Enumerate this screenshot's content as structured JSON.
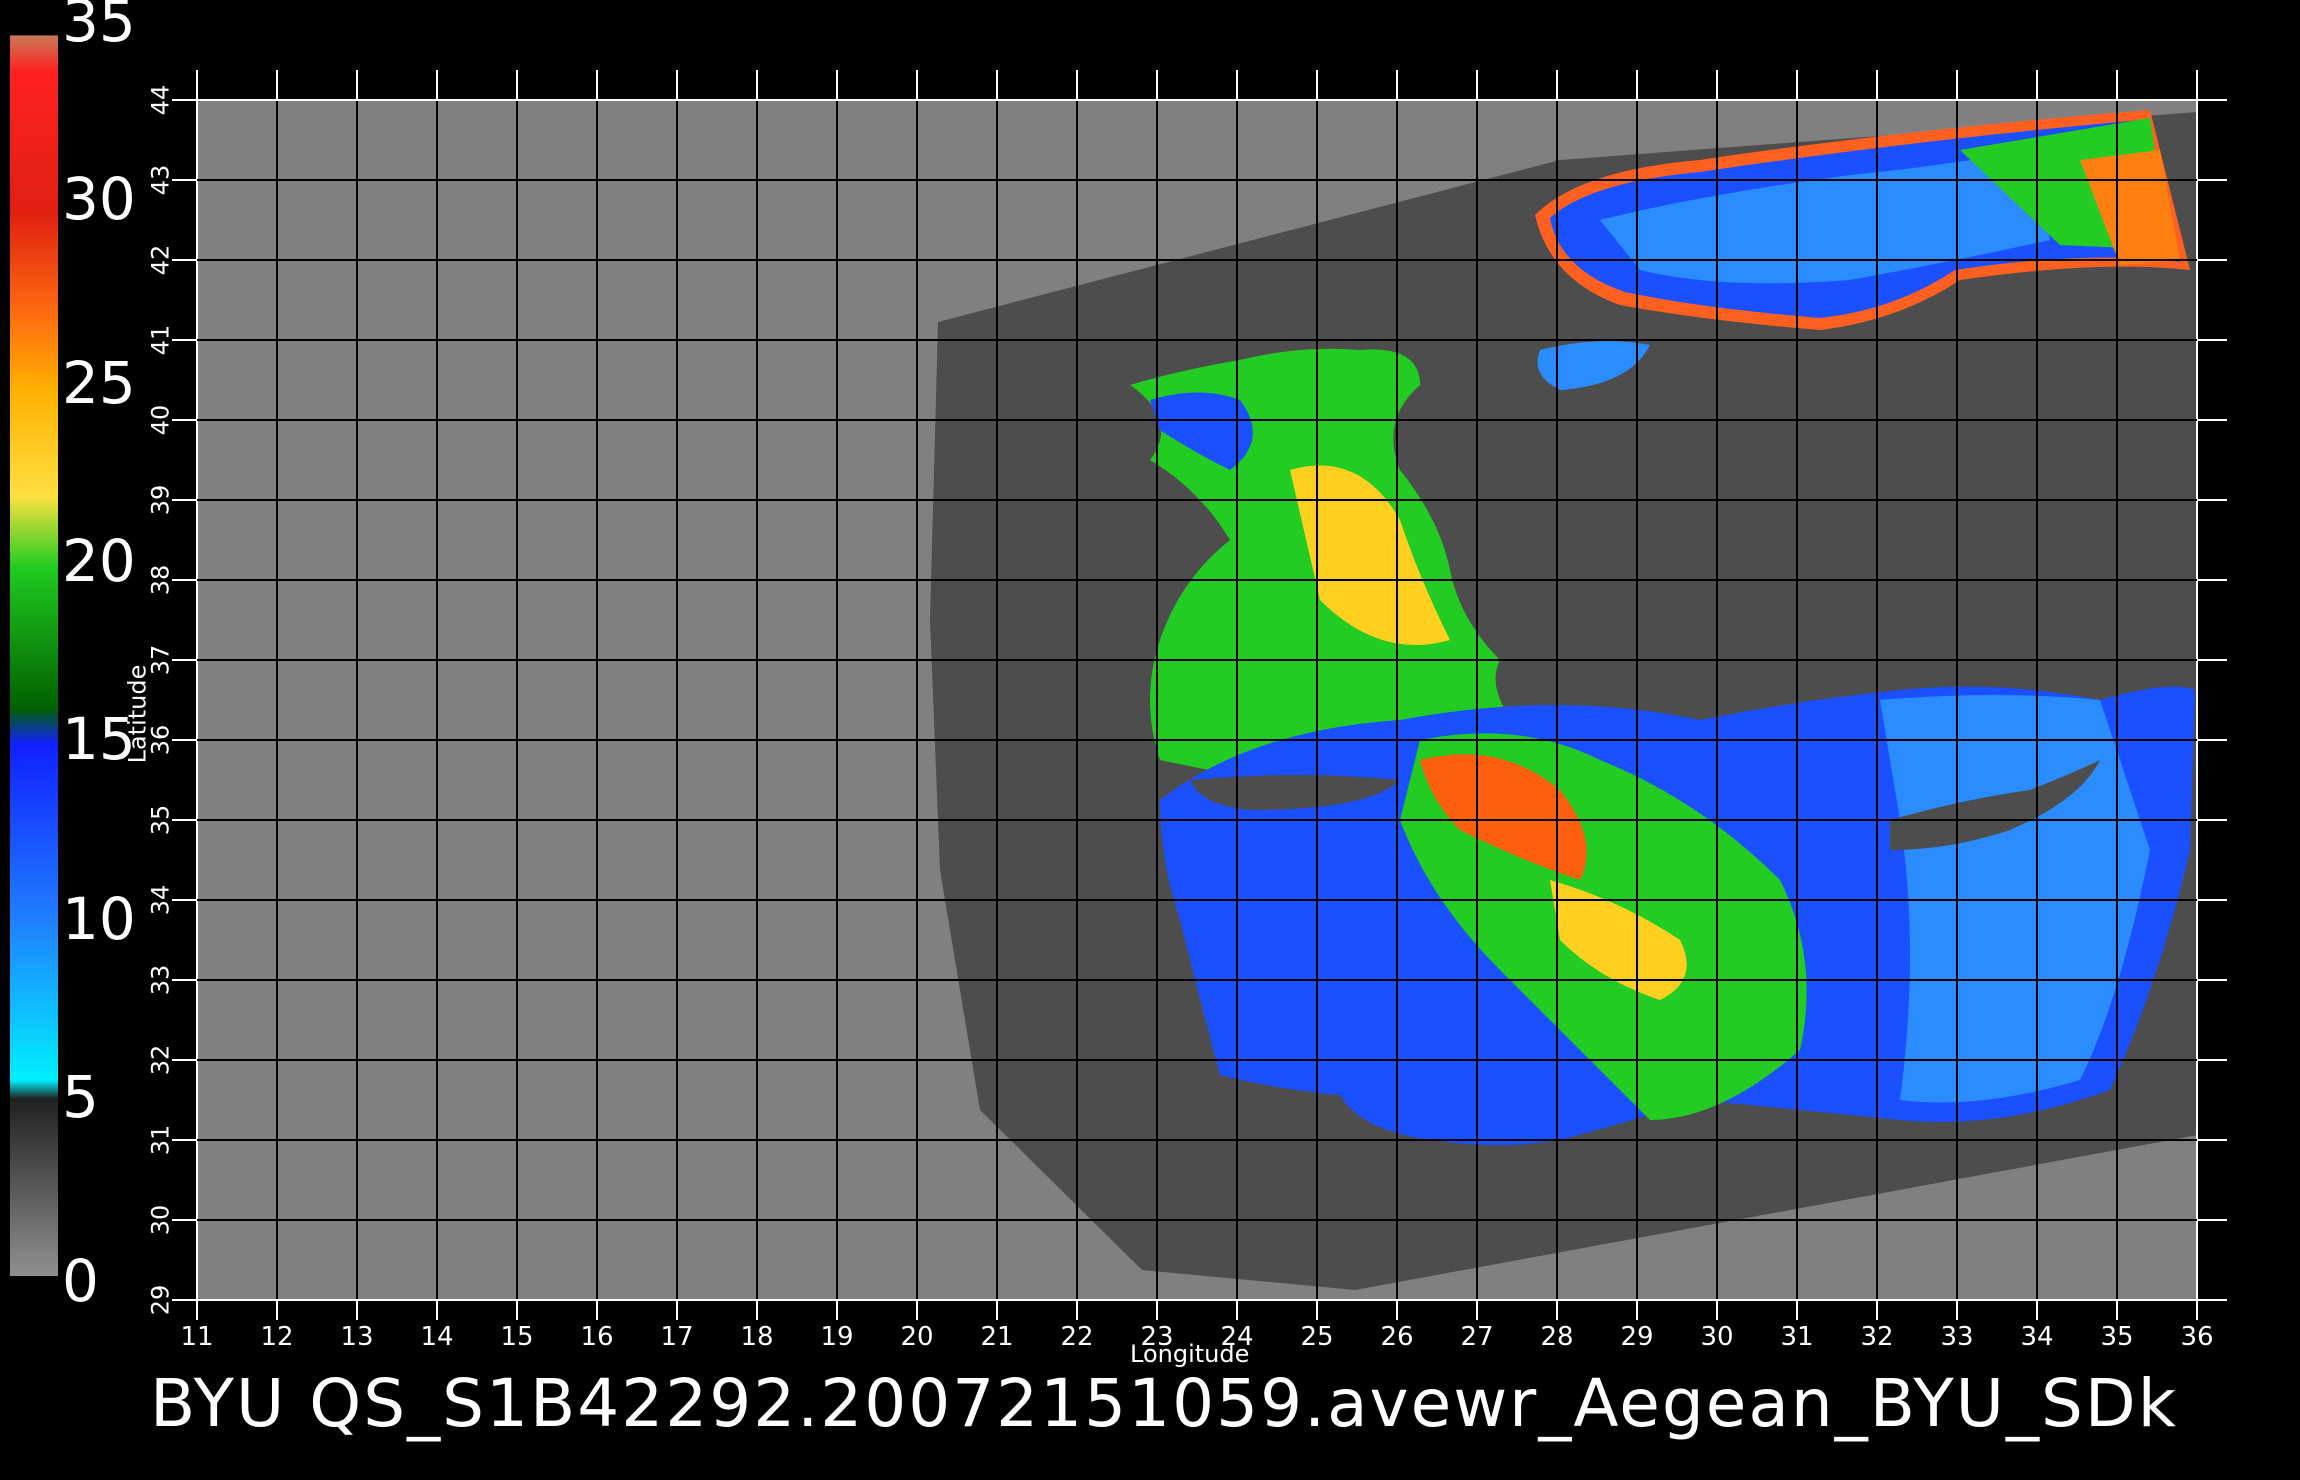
{
  "title": "BYU  QS_S1B42292.20072151059.avewr_Aegean_BYU_SDk",
  "colorbar": {
    "labels": [
      "35",
      "30",
      "25",
      "20",
      "15",
      "10",
      "5",
      "0"
    ],
    "stops": [
      {
        "value": 35,
        "color": "#c87a5a"
      },
      {
        "value": 34,
        "color": "#ff2020"
      },
      {
        "value": 30,
        "color": "#e02010"
      },
      {
        "value": 27,
        "color": "#ff7010"
      },
      {
        "value": 25,
        "color": "#ffb000"
      },
      {
        "value": 22,
        "color": "#ffe040"
      },
      {
        "value": 20,
        "color": "#20cc20"
      },
      {
        "value": 16,
        "color": "#006000"
      },
      {
        "value": 15,
        "color": "#1020ff"
      },
      {
        "value": 10,
        "color": "#2080ff"
      },
      {
        "value": 5.5,
        "color": "#00f0ff"
      },
      {
        "value": 5,
        "color": "#202020"
      },
      {
        "value": 0,
        "color": "#909090"
      }
    ]
  },
  "axes": {
    "xlabel": "Longitude",
    "ylabel": "Latitude",
    "xticks": [
      "11",
      "12",
      "13",
      "14",
      "15",
      "16",
      "17",
      "18",
      "19",
      "20",
      "21",
      "22",
      "23",
      "24",
      "25",
      "26",
      "27",
      "28",
      "29",
      "30",
      "31",
      "32",
      "33",
      "34",
      "35",
      "36"
    ],
    "yticks": [
      "29",
      "30",
      "31",
      "32",
      "33",
      "34",
      "35",
      "36",
      "37",
      "38",
      "39",
      "40",
      "41",
      "42",
      "43",
      "44"
    ]
  },
  "colors": {
    "background": "#000000",
    "land": "#808080",
    "swath": "#4d4d4d",
    "grid": "#000000"
  }
}
